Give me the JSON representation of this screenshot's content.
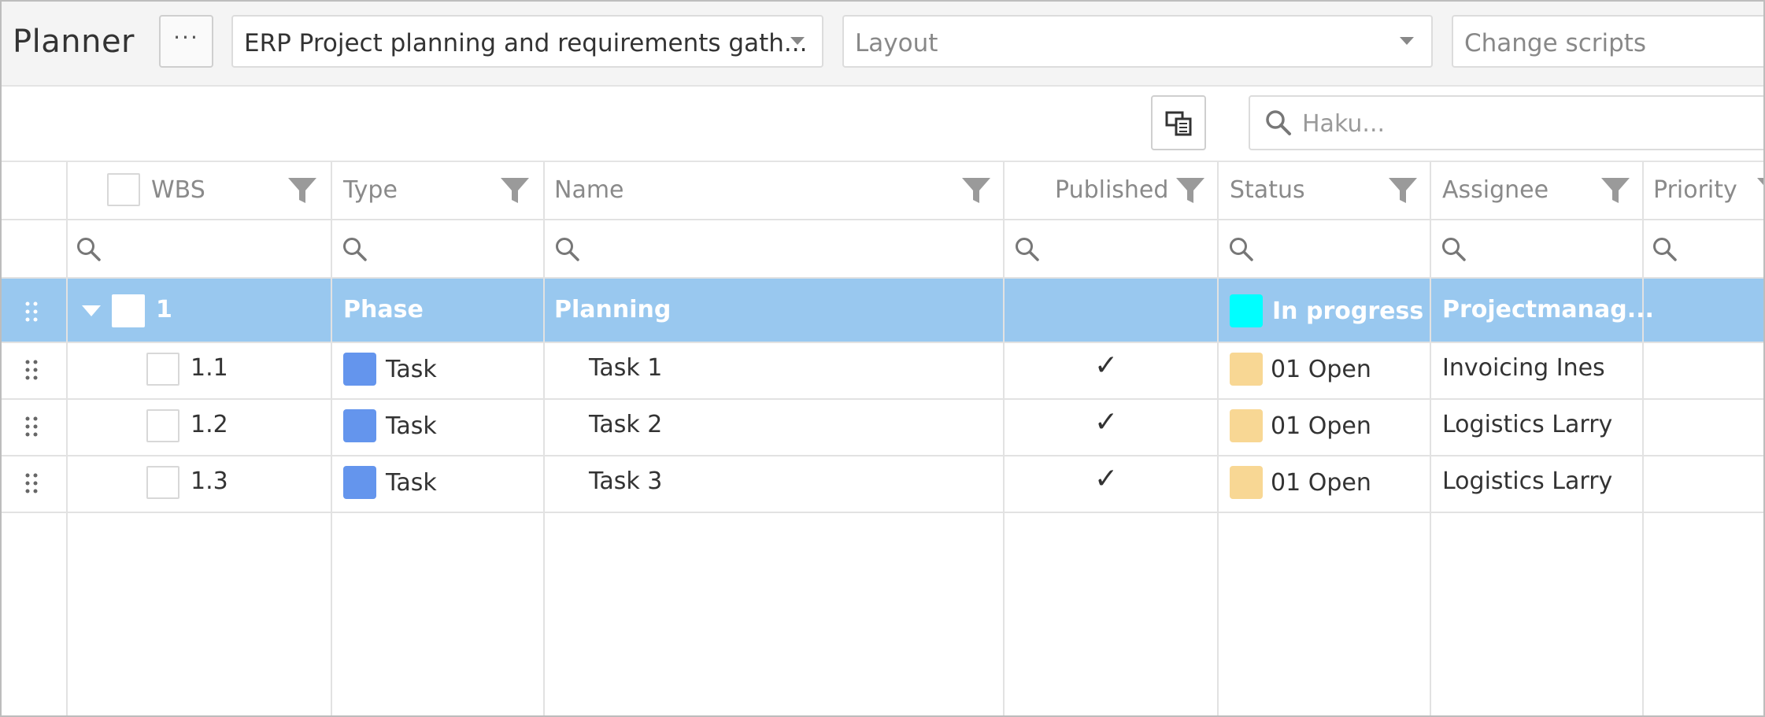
{
  "app": {
    "title": "Planner",
    "more_label": "···"
  },
  "selectors": {
    "project": "ERP Project planning and requirements gath...",
    "layout_placeholder": "Layout",
    "scripts_placeholder": "Change scripts"
  },
  "toolbar": {
    "search_placeholder": "Haku..."
  },
  "columns": [
    {
      "key": "wbs",
      "label": "WBS"
    },
    {
      "key": "type",
      "label": "Type"
    },
    {
      "key": "name",
      "label": "Name"
    },
    {
      "key": "published",
      "label": "Published"
    },
    {
      "key": "status",
      "label": "Status"
    },
    {
      "key": "assignee",
      "label": "Assignee"
    },
    {
      "key": "priority",
      "label": "Priority"
    }
  ],
  "rows": [
    {
      "wbs": "1",
      "type": "Phase",
      "name": "Planning",
      "published": "",
      "status": "In progress",
      "status_color": "#00ffff",
      "assignee": "Projectmanag...",
      "selected": true,
      "expanded": true
    },
    {
      "wbs": "1.1",
      "type": "Task",
      "type_color": "#6495ed",
      "name": "Task 1",
      "published": "✓",
      "status": "01 Open",
      "status_color": "#f8d794",
      "assignee": "Invoicing Ines"
    },
    {
      "wbs": "1.2",
      "type": "Task",
      "type_color": "#6495ed",
      "name": "Task 2",
      "published": "✓",
      "status": "01 Open",
      "status_color": "#f8d794",
      "assignee": "Logistics Larry"
    },
    {
      "wbs": "1.3",
      "type": "Task",
      "type_color": "#6495ed",
      "name": "Task 3",
      "published": "✓",
      "status": "01 Open",
      "status_color": "#f8d794",
      "assignee": "Logistics Larry"
    }
  ],
  "icons": {
    "filter": "funnel-icon",
    "search": "magnifier-icon",
    "drag": "drag-handle-icon",
    "expand": "caret-down-icon",
    "export": "export-icon"
  },
  "colors": {
    "selected_row": "#99c8ef",
    "task_type": "#6495ed",
    "phase_status": "#00ffff",
    "open_status": "#f8d794"
  }
}
